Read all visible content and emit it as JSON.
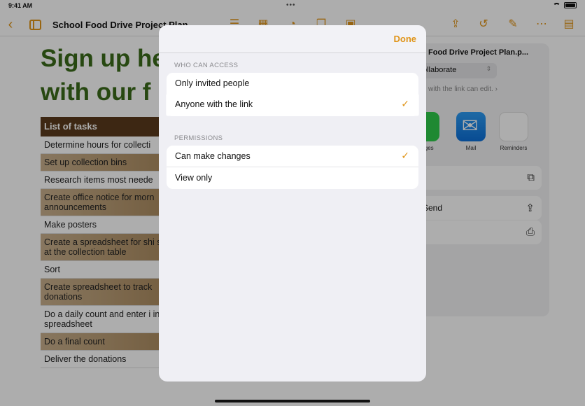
{
  "status": {
    "time": "9:41 AM",
    "dots": "•••"
  },
  "toolbar": {
    "doc_title": "School Food Drive Project Plan"
  },
  "document": {
    "heading_lines": [
      "Sign up he",
      "with our f"
    ],
    "table_header": "List of tasks",
    "tasks": [
      "Determine hours for collecti",
      "Set up collection bins",
      "Research items most neede",
      "Create office notice for morn announcements",
      "Make posters",
      "Create a spreadsheet for shi signup at the collection table",
      "Sort",
      "Create spreadsheet to track donations",
      "Do a daily count and enter i into the spreadsheet",
      "Do a final count",
      "Deliver the donations"
    ]
  },
  "share_panel": {
    "filename": "Food Drive Project Plan.p...",
    "collab_mode": "ollaborate",
    "collab_hint": "with the link can edit. ›",
    "apps": [
      "ssages",
      "Mail",
      "Reminders"
    ],
    "rows": [
      "",
      "Send",
      ""
    ]
  },
  "modal": {
    "done_label": "Done",
    "access_section": "WHO CAN ACCESS",
    "access_options": [
      "Only invited people",
      "Anyone with the link"
    ],
    "permissions_section": "PERMISSIONS",
    "permission_options": [
      "Can make changes",
      "View only"
    ],
    "check_glyph": "✓"
  }
}
